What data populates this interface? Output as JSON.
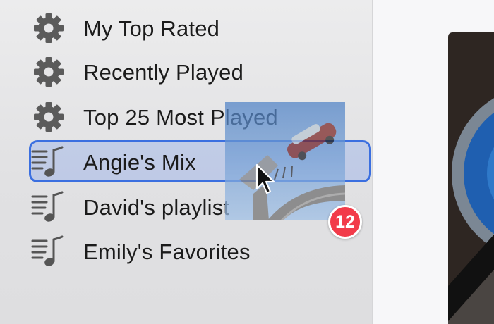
{
  "sidebar": {
    "items": [
      {
        "label": "My Top Rated",
        "icon": "gear-icon"
      },
      {
        "label": "Recently Played",
        "icon": "gear-icon"
      },
      {
        "label": "Top 25 Most Played",
        "icon": "gear-icon"
      },
      {
        "label": "Angie's Mix",
        "icon": "playlist-icon",
        "state": "drop-target"
      },
      {
        "label": "David's playlist",
        "icon": "playlist-icon"
      },
      {
        "label": "Emily's Favorites",
        "icon": "playlist-icon"
      }
    ]
  },
  "drag": {
    "item_count": "12",
    "thumbnail": "album-artwork-thumbnail"
  },
  "colors": {
    "highlight": "#3b6fe0",
    "badge": "#f23b4a",
    "icon": "#5b5b5b"
  }
}
